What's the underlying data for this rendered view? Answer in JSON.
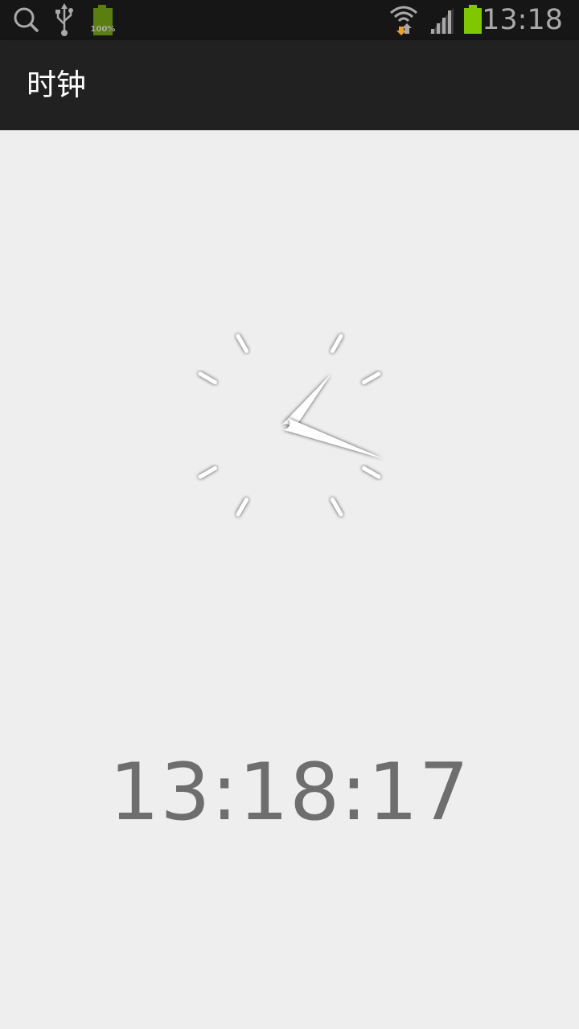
{
  "status_bar": {
    "time": "13:18",
    "battery_level_text": "100%",
    "icons": [
      "search-icon",
      "usb-icon",
      "battery-full-notification-icon",
      "wifi-icon",
      "cell-signal-icon",
      "battery-icon"
    ],
    "colors": {
      "background": "#161616",
      "icon": "#a9a9a9",
      "battery": "#7fc800",
      "battery_notification": "#5a7f10",
      "wifi_arrow": "#f0a020"
    }
  },
  "action_bar": {
    "title": "时钟",
    "background": "#212121"
  },
  "clock": {
    "hour": 13,
    "minute": 18,
    "second": 17,
    "digital_display": "13:18:17",
    "colors": {
      "background": "#eeeeee",
      "digital_text": "#6e6e6e",
      "hand": "#ffffff"
    }
  }
}
